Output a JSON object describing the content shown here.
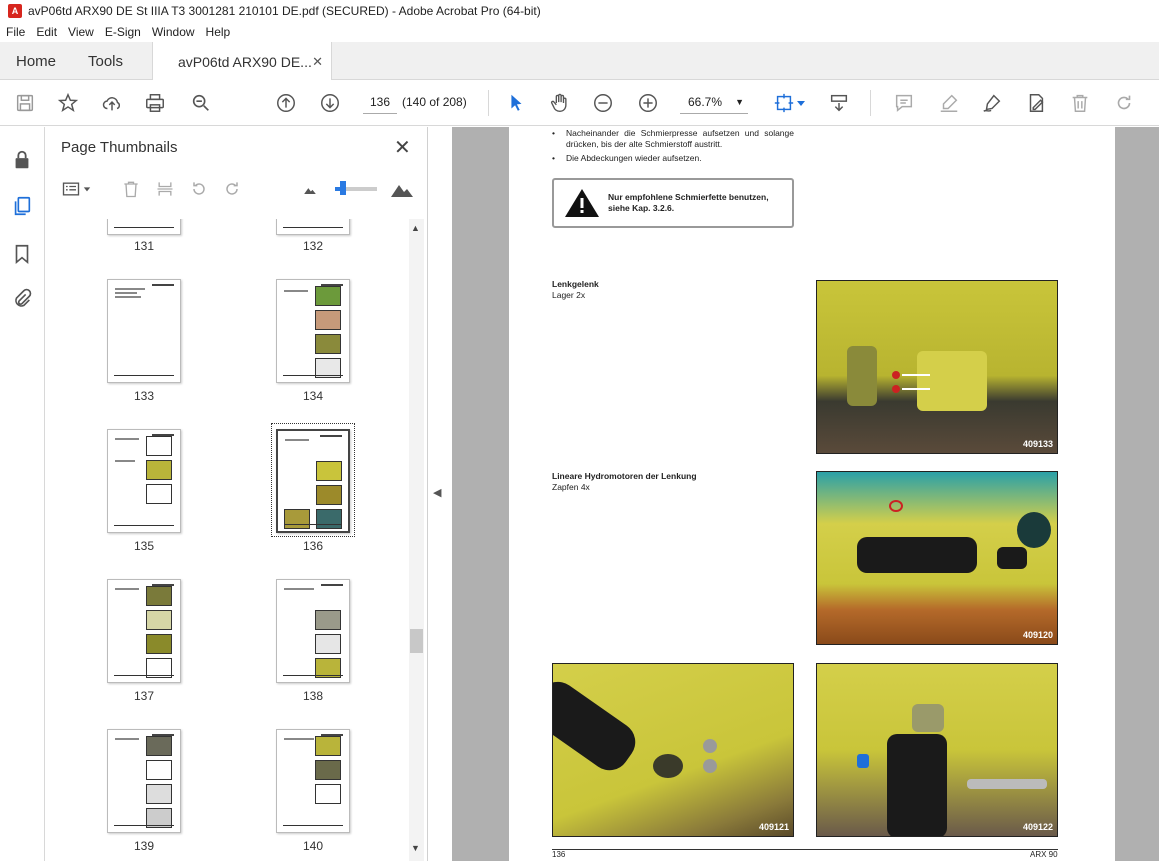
{
  "window": {
    "title": "avP06td ARX90 DE St IIIA T3 3001281 210101 DE.pdf (SECURED) - Adobe Acrobat Pro (64-bit)"
  },
  "menu": [
    "File",
    "Edit",
    "View",
    "E-Sign",
    "Window",
    "Help"
  ],
  "tabs": {
    "home": "Home",
    "tools": "Tools",
    "doc": "avP06td ARX90 DE...",
    "close": "✕"
  },
  "toolbar": {
    "page_number": "136",
    "page_count": "(140 of 208)",
    "zoom": "66.7%"
  },
  "panel": {
    "title": "Page Thumbnails",
    "close": "✕",
    "thumbnails": [
      "131",
      "132",
      "133",
      "134",
      "135",
      "136",
      "137",
      "138",
      "139",
      "140"
    ],
    "selected": "136"
  },
  "document": {
    "bullet1": "Nacheinander die Schmierpresse aufsetzen und solange drücken, bis der alte Schmierstoff austritt.",
    "bullet2": "Die Abdeckungen wieder aufsetzen.",
    "warning": "Nur empfohlene Schmierfette benutzen, siehe Kap. 3.2.6.",
    "section1_title": "Lenkgelenk",
    "section1_sub": "Lager 2x",
    "section2_title": "Lineare Hydromotoren der Lenkung",
    "section2_sub": "Zapfen 4x",
    "photos": [
      "409133",
      "409120",
      "409121",
      "409122"
    ],
    "footer_left": "136",
    "footer_right": "ARX 90"
  }
}
